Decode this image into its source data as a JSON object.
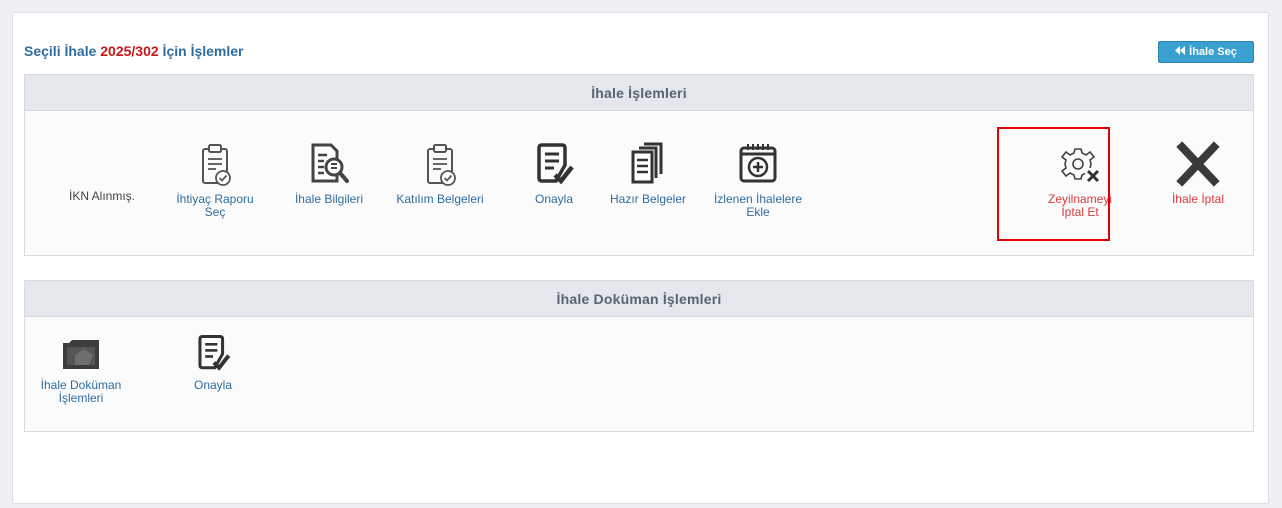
{
  "header": {
    "title_prefix": "Seçili İhale ",
    "ihale_no": "2025/302",
    "title_suffix": " İçin İşlemler",
    "back_button": "İhale Seç"
  },
  "ihale_islemleri": {
    "heading": "İhale İşlemleri",
    "status": "İKN Alınmış.",
    "items": [
      {
        "label": "İhtiyaç Raporu\nSeç",
        "icon": "clipboard-check-icon"
      },
      {
        "label": "İhale Bilgileri",
        "icon": "document-search-icon"
      },
      {
        "label": "Katılım Belgeleri",
        "icon": "clipboard-check-icon"
      },
      {
        "label": "Onayla",
        "icon": "approve-document-icon"
      },
      {
        "label": "Hazır Belgeler",
        "icon": "documents-stack-icon"
      },
      {
        "label": "İzlenen İhalelere\nEkle",
        "icon": "add-to-watchlist-icon"
      },
      {
        "label": "Zeyilnameyi\nİptal Et",
        "icon": "gear-cancel-icon"
      },
      {
        "label": "İhale İptal",
        "icon": "cancel-x-icon"
      }
    ]
  },
  "dokuman_islemleri": {
    "heading": "İhale Doküman İşlemleri",
    "items": [
      {
        "label": "İhale Doküman\nİşlemleri",
        "icon": "folder-icon"
      },
      {
        "label": "Onayla",
        "icon": "approve-document-icon"
      }
    ]
  },
  "colors": {
    "link": "#2f6ca0",
    "danger": "#d83b3b",
    "accent_button": "#3aa0d0",
    "highlight_border": "#e00000"
  }
}
